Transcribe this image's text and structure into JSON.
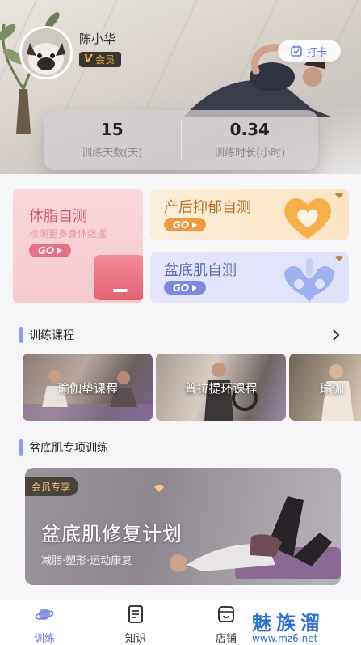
{
  "profile": {
    "name": "陈小华",
    "badge_letter": "V",
    "badge_label": "会员",
    "checkin_label": "打卡"
  },
  "stats": [
    {
      "value": "15",
      "label": "训练天数(天)"
    },
    {
      "value": "0.34",
      "label": "训练时长(小时)"
    }
  ],
  "self_tests": {
    "body_fat": {
      "title": "体脂自测",
      "subtitle": "检测更多身体数据",
      "go": "GO"
    },
    "postpartum": {
      "title": "产后抑郁自测",
      "go": "GO"
    },
    "pelvic": {
      "title": "盆底肌自测",
      "go": "GO"
    }
  },
  "courses_section": {
    "title": "训练课程",
    "items": [
      {
        "label": "瑜伽垫课程"
      },
      {
        "label": "普拉提环课程"
      },
      {
        "label": "瑜伽"
      }
    ]
  },
  "pelvic_section": {
    "title": "盆底肌专项训练",
    "banner": {
      "vip_label": "会员专享",
      "title": "盆底肌修复计划",
      "subtitle": "减脂·塑形·运动康复"
    }
  },
  "tabbar": [
    {
      "label": "训练",
      "active": true,
      "icon": "planet-icon"
    },
    {
      "label": "知识",
      "active": false,
      "icon": "book-icon"
    },
    {
      "label": "店铺",
      "active": false,
      "icon": "shop-icon"
    }
  ],
  "watermark": {
    "text": "魅族溜",
    "url": "www.mz6.net"
  },
  "colors": {
    "accent": "#6d7ee0",
    "pink": "#d2576b",
    "orange": "#ef9a43",
    "indigo": "#5d68b6"
  }
}
